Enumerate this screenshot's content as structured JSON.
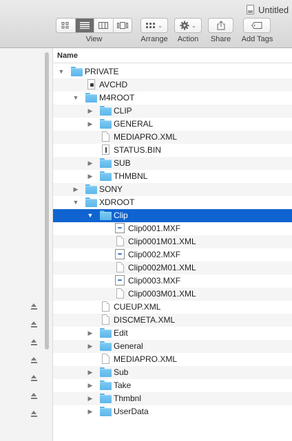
{
  "window": {
    "title": "Untitled"
  },
  "toolbar": {
    "view_label": "View",
    "arrange_label": "Arrange",
    "action_label": "Action",
    "share_label": "Share",
    "add_tags_label": "Add Tags",
    "view_modes": [
      "icon-view-icon",
      "list-view-icon",
      "column-view-icon",
      "cover-flow-icon"
    ],
    "active_view": "list-view-icon"
  },
  "list": {
    "column_header": "Name",
    "selected_color": "#0f64d2",
    "folder_color": "#6cc0f0",
    "rows": [
      {
        "name": "PRIVATE",
        "depth": 0,
        "type": "folder",
        "disclosure": "open"
      },
      {
        "name": "AVCHD",
        "depth": 1,
        "type": "alias",
        "disclosure": "none"
      },
      {
        "name": "M4ROOT",
        "depth": 1,
        "type": "folder",
        "disclosure": "open"
      },
      {
        "name": "CLIP",
        "depth": 2,
        "type": "folder",
        "disclosure": "closed"
      },
      {
        "name": "GENERAL",
        "depth": 2,
        "type": "folder",
        "disclosure": "closed"
      },
      {
        "name": "MEDIAPRO.XML",
        "depth": 2,
        "type": "doc",
        "disclosure": "none"
      },
      {
        "name": "STATUS.BIN",
        "depth": 2,
        "type": "bin",
        "disclosure": "none"
      },
      {
        "name": "SUB",
        "depth": 2,
        "type": "folder",
        "disclosure": "closed"
      },
      {
        "name": "THMBNL",
        "depth": 2,
        "type": "folder",
        "disclosure": "closed"
      },
      {
        "name": "SONY",
        "depth": 1,
        "type": "folder",
        "disclosure": "closed"
      },
      {
        "name": "XDROOT",
        "depth": 1,
        "type": "folder",
        "disclosure": "open"
      },
      {
        "name": "Clip",
        "depth": 2,
        "type": "folder",
        "disclosure": "open",
        "selected": true
      },
      {
        "name": "Clip0001.MXF",
        "depth": 3,
        "type": "mxf",
        "disclosure": "none"
      },
      {
        "name": "Clip0001M01.XML",
        "depth": 3,
        "type": "doc",
        "disclosure": "none"
      },
      {
        "name": "Clip0002.MXF",
        "depth": 3,
        "type": "mxf",
        "disclosure": "none"
      },
      {
        "name": "Clip0002M01.XML",
        "depth": 3,
        "type": "doc",
        "disclosure": "none"
      },
      {
        "name": "Clip0003.MXF",
        "depth": 3,
        "type": "mxf",
        "disclosure": "none"
      },
      {
        "name": "Clip0003M01.XML",
        "depth": 3,
        "type": "doc",
        "disclosure": "none"
      },
      {
        "name": "CUEUP.XML",
        "depth": 2,
        "type": "doc",
        "disclosure": "none"
      },
      {
        "name": "DISCMETA.XML",
        "depth": 2,
        "type": "doc",
        "disclosure": "none"
      },
      {
        "name": "Edit",
        "depth": 2,
        "type": "folder",
        "disclosure": "closed"
      },
      {
        "name": "General",
        "depth": 2,
        "type": "folder",
        "disclosure": "closed"
      },
      {
        "name": "MEDIAPRO.XML",
        "depth": 2,
        "type": "doc",
        "disclosure": "none"
      },
      {
        "name": "Sub",
        "depth": 2,
        "type": "folder",
        "disclosure": "closed"
      },
      {
        "name": "Take",
        "depth": 2,
        "type": "folder",
        "disclosure": "closed"
      },
      {
        "name": "Thmbnl",
        "depth": 2,
        "type": "folder",
        "disclosure": "closed"
      },
      {
        "name": "UserData",
        "depth": 2,
        "type": "folder",
        "disclosure": "closed"
      }
    ]
  },
  "sidebar": {
    "eject_buttons": [
      "eject-icon",
      "eject-icon",
      "eject-icon",
      "eject-icon",
      "eject-icon",
      "eject-icon",
      "eject-icon"
    ]
  }
}
